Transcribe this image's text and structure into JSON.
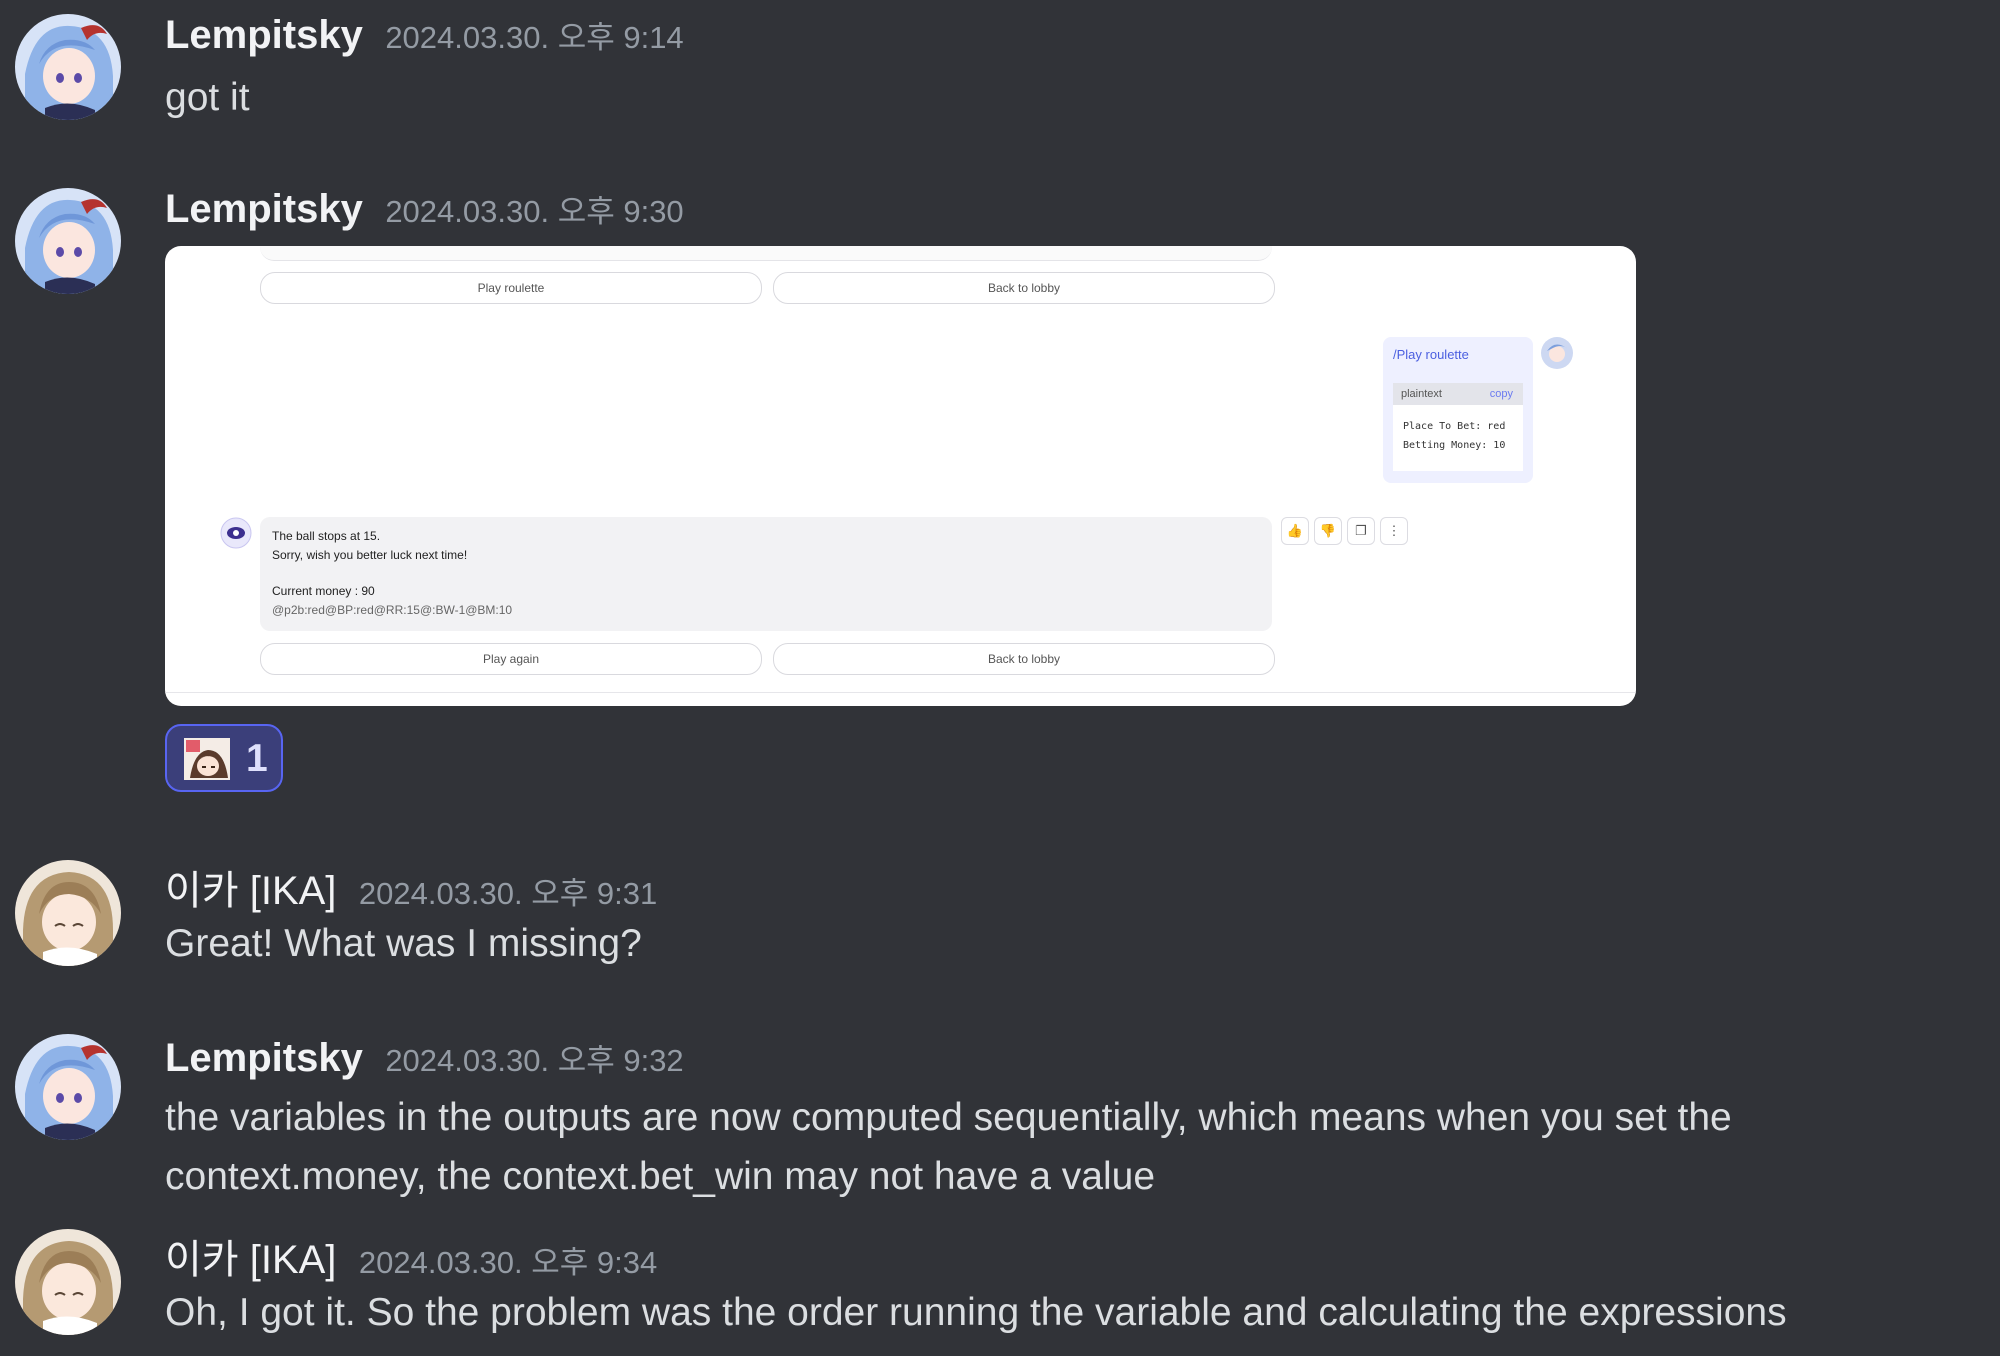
{
  "messages": [
    {
      "username": "Lempitsky",
      "timestamp": "2024.03.30. 오후 9:14",
      "lines": [
        "got it"
      ]
    },
    {
      "username": "Lempitsky",
      "timestamp": "2024.03.30. 오후 9:30",
      "lines": []
    },
    {
      "username": "이카 [IKA]",
      "timestamp": "2024.03.30. 오후 9:31",
      "lines": [
        "Great! What was I missing?"
      ]
    },
    {
      "username": "Lempitsky",
      "timestamp": "2024.03.30. 오후 9:32",
      "lines": [
        "the variables in the outputs are now computed sequentially, which means when you set the",
        "context.money, the context.bet_win may not have a value"
      ]
    },
    {
      "username": "이카 [IKA]",
      "timestamp": "2024.03.30. 오후 9:34",
      "lines": [
        "Oh, I got it. So the problem was the order running the variable and calculating the expressions"
      ]
    }
  ],
  "embed": {
    "top_buttons": [
      "Play roulette",
      "Back to lobby"
    ],
    "user_command": "/Play roulette",
    "code_lang": "plaintext",
    "code_copy": "copy",
    "code_lines": [
      "Place To Bet: red",
      "Betting Money: 10"
    ],
    "bot_lines": [
      "The ball stops at 15.",
      "Sorry, wish you better luck next time!",
      "Current money : 90",
      "@p2b:red@BP:red@RR:15@:BW-1@BM:10"
    ],
    "action_icons": [
      "thumbs-up-icon",
      "thumbs-down-icon",
      "copy-icon",
      "more-icon"
    ],
    "bottom_buttons": [
      "Play again",
      "Back to lobby"
    ]
  },
  "reaction": {
    "count": "1",
    "emoji": "custom-character-emoji"
  }
}
